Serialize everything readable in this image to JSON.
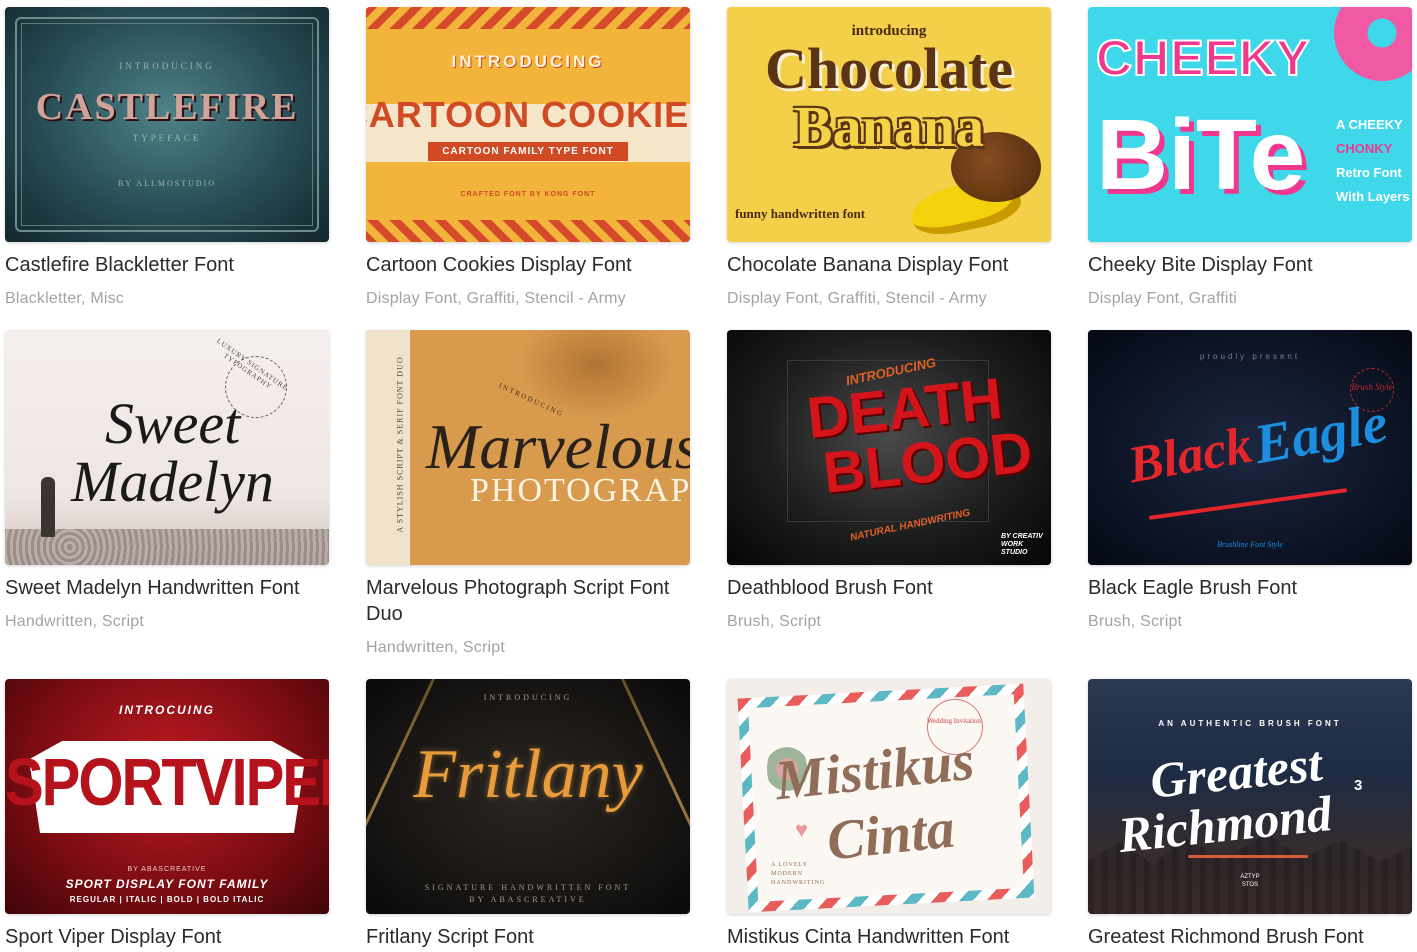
{
  "fonts": [
    {
      "title": "Castlefire Blackletter Font",
      "categories": [
        "Blackletter",
        "Misc"
      ],
      "thumb": {
        "intro": "INTRODUCING",
        "name": "CASTLEFIRE",
        "sub": "TYPEFACE",
        "byline": "BY ALLMOSTUDIO"
      }
    },
    {
      "title": "Cartoon Cookies Display Font",
      "categories": [
        "Display Font",
        "Graffiti",
        "Stencil - Army"
      ],
      "thumb": {
        "intro": "INTRODUCING",
        "name": "CARTOON COOKIES",
        "sub": "CARTOON FAMILY TYPE FONT",
        "byline": "CRAFTED FONT BY KONG FONT"
      }
    },
    {
      "title": "Chocolate Banana Display Font",
      "categories": [
        "Display Font",
        "Graffiti",
        "Stencil - Army"
      ],
      "thumb": {
        "intro": "introducing",
        "name": "Chocolate",
        "name2": "Banana",
        "sub": "funny handwritten font"
      }
    },
    {
      "title": "Cheeky Bite Display Font",
      "categories": [
        "Display Font",
        "Graffiti"
      ],
      "thumb": {
        "name": "CHEEKY",
        "name2": "BiTe",
        "side": [
          "A CHEEKY",
          "CHONKY",
          "Retro Font",
          "With Layers"
        ]
      }
    },
    {
      "title": "Sweet Madelyn Handwritten Font",
      "categories": [
        "Handwritten",
        "Script"
      ],
      "thumb": {
        "name": "Sweet",
        "name2": "Madelyn",
        "sub": "LUXURY SIGNATURE TYPOGRAPHY"
      }
    },
    {
      "title": "Marvelous Photograph Script Font Duo",
      "categories": [
        "Handwritten",
        "Script"
      ],
      "thumb": {
        "intro": "INTRODUCING",
        "name": "Marvelous",
        "name2": "PHOTOGRAPH",
        "side": "A STYLISH SCRIPT & SERIF FONT DUO"
      }
    },
    {
      "title": "Deathblood Brush Font",
      "categories": [
        "Brush",
        "Script"
      ],
      "thumb": {
        "intro": "INTRODUCING",
        "name": "DEATH",
        "name2": "BLOOD",
        "sub": "NATURAL HANDWRITING",
        "byline": "BY CREATIV WORK STUDIO"
      }
    },
    {
      "title": "Black Eagle Brush Font",
      "categories": [
        "Brush",
        "Script"
      ],
      "thumb": {
        "intro": "proudly present",
        "name": "Black",
        "name2": "Eagle",
        "sub": "Brushline Font Style",
        "badge": "Brush Style"
      }
    },
    {
      "title": "Sport Viper Display Font",
      "categories": [],
      "thumb": {
        "intro": "INTROCUING",
        "name": "SPORTVIPER",
        "by": "BY ABASCREATIVE",
        "sub": "SPORT DISPLAY FONT FAMILY",
        "byline": "REGULAR | ITALIC | BOLD | BOLD ITALIC"
      }
    },
    {
      "title": "Fritlany Script Font",
      "categories": [],
      "thumb": {
        "intro": "INTRODUCING",
        "name": "Fritlany",
        "sub": "SIGNATURE HANDWRITTEN FONT",
        "byline": "BY ABASCREATIVE"
      }
    },
    {
      "title": "Mistikus Cinta Handwritten Font",
      "categories": [],
      "thumb": {
        "name": "Mistikus",
        "name2": "Cinta",
        "sub": "A LOVELY MODERN HANDWRITING",
        "stamp": "Wedding Invitation"
      }
    },
    {
      "title": "Greatest Richmond Brush Font",
      "categories": [],
      "thumb": {
        "intro": "AN AUTHENTIC BRUSH FONT",
        "name": "Greatest",
        "name2": "Richmond",
        "badge": "3",
        "byline": "AZTYP STOS"
      }
    }
  ]
}
